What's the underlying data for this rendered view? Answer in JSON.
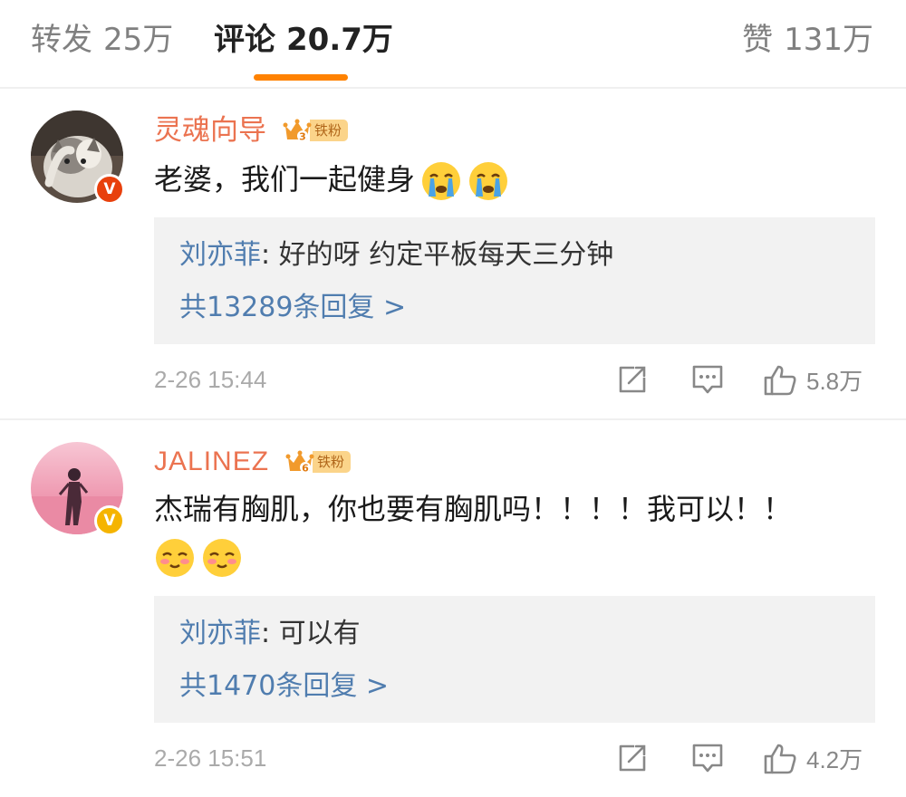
{
  "tabs": {
    "repost": {
      "label": "转发",
      "count": "25万"
    },
    "comment": {
      "label": "评论",
      "count": "20.7万"
    },
    "like": {
      "label": "赞",
      "count": "131万"
    }
  },
  "colors": {
    "accent": "#ff8200",
    "username": "#eb7350",
    "link": "#507daf",
    "reply_bg": "#f2f2f2",
    "muted": "#aaaaaa"
  },
  "comments": [
    {
      "username": "灵魂向导",
      "fan_level": "3",
      "fan_label": "铁粉",
      "verified": "red-v-badge",
      "text": "老婆，我们一起健身",
      "emojis": [
        "crying-emoji",
        "crying-emoji"
      ],
      "reply": {
        "author": "刘亦菲",
        "text": "好的呀 约定平板每天三分钟"
      },
      "reply_count": "共13289条回复 >",
      "time": "2-26 15:44",
      "likes": "5.8万"
    },
    {
      "username": "JALINEZ",
      "fan_level": "6",
      "fan_label": "铁粉",
      "verified": "gold-v-badge",
      "text": "杰瑞有胸肌，你也要有胸肌吗！！！！我可以！！",
      "emojis": [
        "shy-smile-emoji",
        "shy-smile-emoji"
      ],
      "reply": {
        "author": "刘亦菲",
        "text": "可以有"
      },
      "reply_count": "共1470条回复 >",
      "time": "2-26 15:51",
      "likes": "4.2万"
    }
  ]
}
